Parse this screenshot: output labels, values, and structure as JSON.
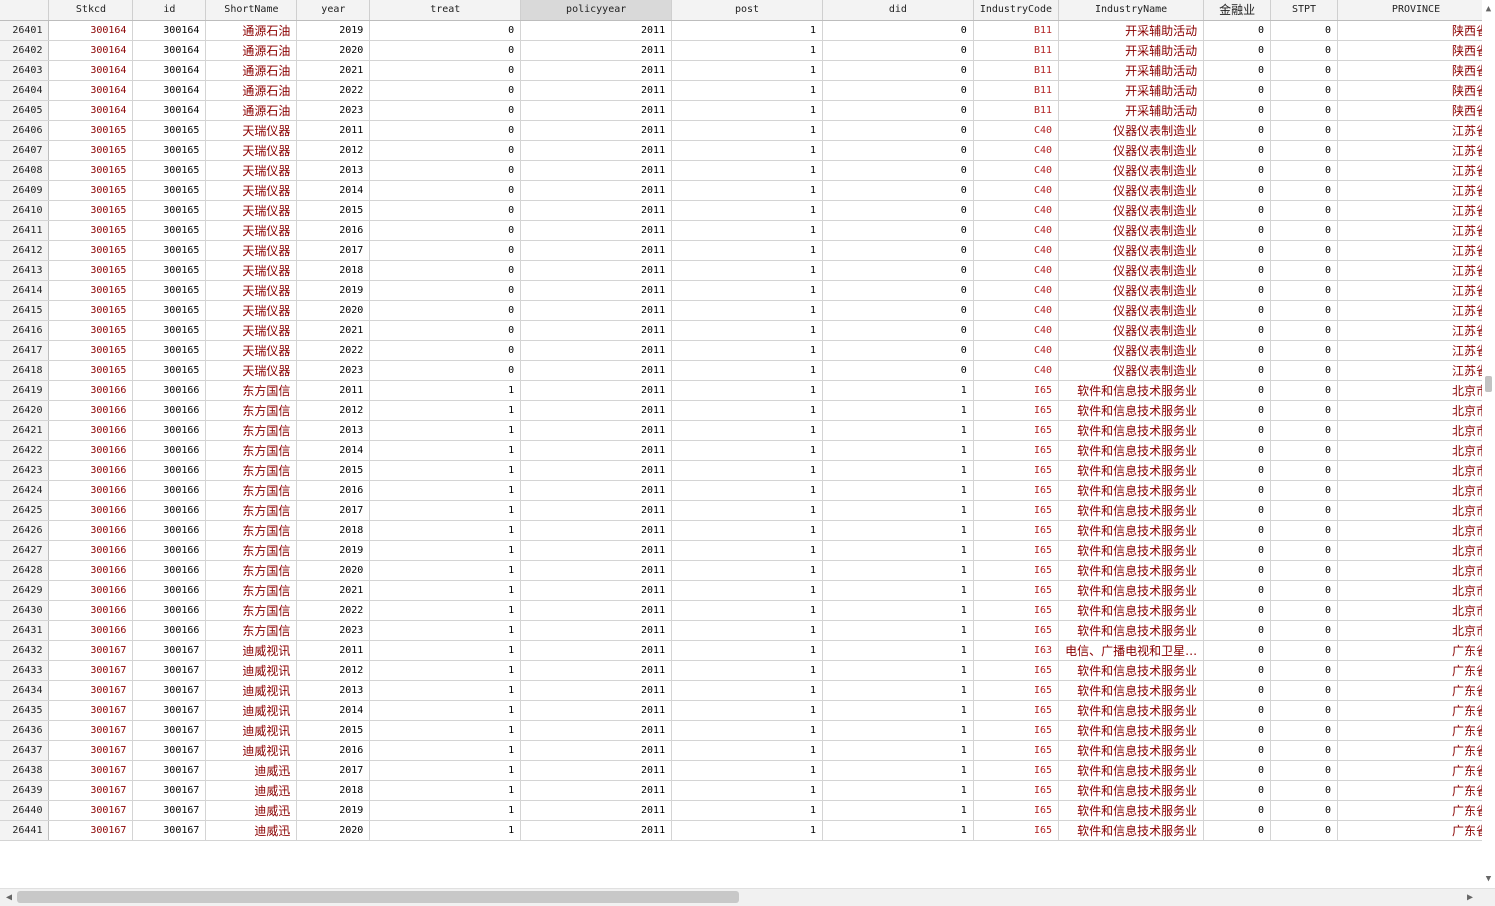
{
  "columns": [
    "",
    "Stkcd",
    "id",
    "ShortName",
    "year",
    "treat",
    "policyyear",
    "post",
    "did",
    "IndustryCode",
    "IndustryName",
    "金融业",
    "STPT",
    "PROVINCE"
  ],
  "rows": [
    [
      "26401",
      "300164",
      "300164",
      "通源石油",
      "2019",
      "0",
      "2011",
      "1",
      "0",
      "B11",
      "开采辅助活动",
      "0",
      "0",
      "陕西省"
    ],
    [
      "26402",
      "300164",
      "300164",
      "通源石油",
      "2020",
      "0",
      "2011",
      "1",
      "0",
      "B11",
      "开采辅助活动",
      "0",
      "0",
      "陕西省"
    ],
    [
      "26403",
      "300164",
      "300164",
      "通源石油",
      "2021",
      "0",
      "2011",
      "1",
      "0",
      "B11",
      "开采辅助活动",
      "0",
      "0",
      "陕西省"
    ],
    [
      "26404",
      "300164",
      "300164",
      "通源石油",
      "2022",
      "0",
      "2011",
      "1",
      "0",
      "B11",
      "开采辅助活动",
      "0",
      "0",
      "陕西省"
    ],
    [
      "26405",
      "300164",
      "300164",
      "通源石油",
      "2023",
      "0",
      "2011",
      "1",
      "0",
      "B11",
      "开采辅助活动",
      "0",
      "0",
      "陕西省"
    ],
    [
      "26406",
      "300165",
      "300165",
      "天瑞仪器",
      "2011",
      "0",
      "2011",
      "1",
      "0",
      "C40",
      "仪器仪表制造业",
      "0",
      "0",
      "江苏省"
    ],
    [
      "26407",
      "300165",
      "300165",
      "天瑞仪器",
      "2012",
      "0",
      "2011",
      "1",
      "0",
      "C40",
      "仪器仪表制造业",
      "0",
      "0",
      "江苏省"
    ],
    [
      "26408",
      "300165",
      "300165",
      "天瑞仪器",
      "2013",
      "0",
      "2011",
      "1",
      "0",
      "C40",
      "仪器仪表制造业",
      "0",
      "0",
      "江苏省"
    ],
    [
      "26409",
      "300165",
      "300165",
      "天瑞仪器",
      "2014",
      "0",
      "2011",
      "1",
      "0",
      "C40",
      "仪器仪表制造业",
      "0",
      "0",
      "江苏省"
    ],
    [
      "26410",
      "300165",
      "300165",
      "天瑞仪器",
      "2015",
      "0",
      "2011",
      "1",
      "0",
      "C40",
      "仪器仪表制造业",
      "0",
      "0",
      "江苏省"
    ],
    [
      "26411",
      "300165",
      "300165",
      "天瑞仪器",
      "2016",
      "0",
      "2011",
      "1",
      "0",
      "C40",
      "仪器仪表制造业",
      "0",
      "0",
      "江苏省"
    ],
    [
      "26412",
      "300165",
      "300165",
      "天瑞仪器",
      "2017",
      "0",
      "2011",
      "1",
      "0",
      "C40",
      "仪器仪表制造业",
      "0",
      "0",
      "江苏省"
    ],
    [
      "26413",
      "300165",
      "300165",
      "天瑞仪器",
      "2018",
      "0",
      "2011",
      "1",
      "0",
      "C40",
      "仪器仪表制造业",
      "0",
      "0",
      "江苏省"
    ],
    [
      "26414",
      "300165",
      "300165",
      "天瑞仪器",
      "2019",
      "0",
      "2011",
      "1",
      "0",
      "C40",
      "仪器仪表制造业",
      "0",
      "0",
      "江苏省"
    ],
    [
      "26415",
      "300165",
      "300165",
      "天瑞仪器",
      "2020",
      "0",
      "2011",
      "1",
      "0",
      "C40",
      "仪器仪表制造业",
      "0",
      "0",
      "江苏省"
    ],
    [
      "26416",
      "300165",
      "300165",
      "天瑞仪器",
      "2021",
      "0",
      "2011",
      "1",
      "0",
      "C40",
      "仪器仪表制造业",
      "0",
      "0",
      "江苏省"
    ],
    [
      "26417",
      "300165",
      "300165",
      "天瑞仪器",
      "2022",
      "0",
      "2011",
      "1",
      "0",
      "C40",
      "仪器仪表制造业",
      "0",
      "0",
      "江苏省"
    ],
    [
      "26418",
      "300165",
      "300165",
      "天瑞仪器",
      "2023",
      "0",
      "2011",
      "1",
      "0",
      "C40",
      "仪器仪表制造业",
      "0",
      "0",
      "江苏省"
    ],
    [
      "26419",
      "300166",
      "300166",
      "东方国信",
      "2011",
      "1",
      "2011",
      "1",
      "1",
      "I65",
      "软件和信息技术服务业",
      "0",
      "0",
      "北京市"
    ],
    [
      "26420",
      "300166",
      "300166",
      "东方国信",
      "2012",
      "1",
      "2011",
      "1",
      "1",
      "I65",
      "软件和信息技术服务业",
      "0",
      "0",
      "北京市"
    ],
    [
      "26421",
      "300166",
      "300166",
      "东方国信",
      "2013",
      "1",
      "2011",
      "1",
      "1",
      "I65",
      "软件和信息技术服务业",
      "0",
      "0",
      "北京市"
    ],
    [
      "26422",
      "300166",
      "300166",
      "东方国信",
      "2014",
      "1",
      "2011",
      "1",
      "1",
      "I65",
      "软件和信息技术服务业",
      "0",
      "0",
      "北京市"
    ],
    [
      "26423",
      "300166",
      "300166",
      "东方国信",
      "2015",
      "1",
      "2011",
      "1",
      "1",
      "I65",
      "软件和信息技术服务业",
      "0",
      "0",
      "北京市"
    ],
    [
      "26424",
      "300166",
      "300166",
      "东方国信",
      "2016",
      "1",
      "2011",
      "1",
      "1",
      "I65",
      "软件和信息技术服务业",
      "0",
      "0",
      "北京市"
    ],
    [
      "26425",
      "300166",
      "300166",
      "东方国信",
      "2017",
      "1",
      "2011",
      "1",
      "1",
      "I65",
      "软件和信息技术服务业",
      "0",
      "0",
      "北京市"
    ],
    [
      "26426",
      "300166",
      "300166",
      "东方国信",
      "2018",
      "1",
      "2011",
      "1",
      "1",
      "I65",
      "软件和信息技术服务业",
      "0",
      "0",
      "北京市"
    ],
    [
      "26427",
      "300166",
      "300166",
      "东方国信",
      "2019",
      "1",
      "2011",
      "1",
      "1",
      "I65",
      "软件和信息技术服务业",
      "0",
      "0",
      "北京市"
    ],
    [
      "26428",
      "300166",
      "300166",
      "东方国信",
      "2020",
      "1",
      "2011",
      "1",
      "1",
      "I65",
      "软件和信息技术服务业",
      "0",
      "0",
      "北京市"
    ],
    [
      "26429",
      "300166",
      "300166",
      "东方国信",
      "2021",
      "1",
      "2011",
      "1",
      "1",
      "I65",
      "软件和信息技术服务业",
      "0",
      "0",
      "北京市"
    ],
    [
      "26430",
      "300166",
      "300166",
      "东方国信",
      "2022",
      "1",
      "2011",
      "1",
      "1",
      "I65",
      "软件和信息技术服务业",
      "0",
      "0",
      "北京市"
    ],
    [
      "26431",
      "300166",
      "300166",
      "东方国信",
      "2023",
      "1",
      "2011",
      "1",
      "1",
      "I65",
      "软件和信息技术服务业",
      "0",
      "0",
      "北京市"
    ],
    [
      "26432",
      "300167",
      "300167",
      "迪威视讯",
      "2011",
      "1",
      "2011",
      "1",
      "1",
      "I63",
      "电信、广播电视和卫星…",
      "0",
      "0",
      "广东省"
    ],
    [
      "26433",
      "300167",
      "300167",
      "迪威视讯",
      "2012",
      "1",
      "2011",
      "1",
      "1",
      "I65",
      "软件和信息技术服务业",
      "0",
      "0",
      "广东省"
    ],
    [
      "26434",
      "300167",
      "300167",
      "迪威视讯",
      "2013",
      "1",
      "2011",
      "1",
      "1",
      "I65",
      "软件和信息技术服务业",
      "0",
      "0",
      "广东省"
    ],
    [
      "26435",
      "300167",
      "300167",
      "迪威视讯",
      "2014",
      "1",
      "2011",
      "1",
      "1",
      "I65",
      "软件和信息技术服务业",
      "0",
      "0",
      "广东省"
    ],
    [
      "26436",
      "300167",
      "300167",
      "迪威视讯",
      "2015",
      "1",
      "2011",
      "1",
      "1",
      "I65",
      "软件和信息技术服务业",
      "0",
      "0",
      "广东省"
    ],
    [
      "26437",
      "300167",
      "300167",
      "迪威视讯",
      "2016",
      "1",
      "2011",
      "1",
      "1",
      "I65",
      "软件和信息技术服务业",
      "0",
      "0",
      "广东省"
    ],
    [
      "26438",
      "300167",
      "300167",
      "迪威迅",
      "2017",
      "1",
      "2011",
      "1",
      "1",
      "I65",
      "软件和信息技术服务业",
      "0",
      "0",
      "广东省"
    ],
    [
      "26439",
      "300167",
      "300167",
      "迪威迅",
      "2018",
      "1",
      "2011",
      "1",
      "1",
      "I65",
      "软件和信息技术服务业",
      "0",
      "0",
      "广东省"
    ],
    [
      "26440",
      "300167",
      "300167",
      "迪威迅",
      "2019",
      "1",
      "2011",
      "1",
      "1",
      "I65",
      "软件和信息技术服务业",
      "0",
      "0",
      "广东省"
    ],
    [
      "26441",
      "300167",
      "300167",
      "迪威迅",
      "2020",
      "1",
      "2011",
      "1",
      "1",
      "I65",
      "软件和信息技术服务业",
      "0",
      "0",
      "广东省"
    ]
  ],
  "selected_column": "policyyear",
  "colors": {
    "string_cells": "#8b0000",
    "header_bg": "#f3f3f3",
    "selected_header_bg": "#d9d9d9"
  },
  "icons": {
    "scroll_up": "▲",
    "scroll_down": "▼",
    "scroll_left": "◀",
    "scroll_right": "▶"
  }
}
